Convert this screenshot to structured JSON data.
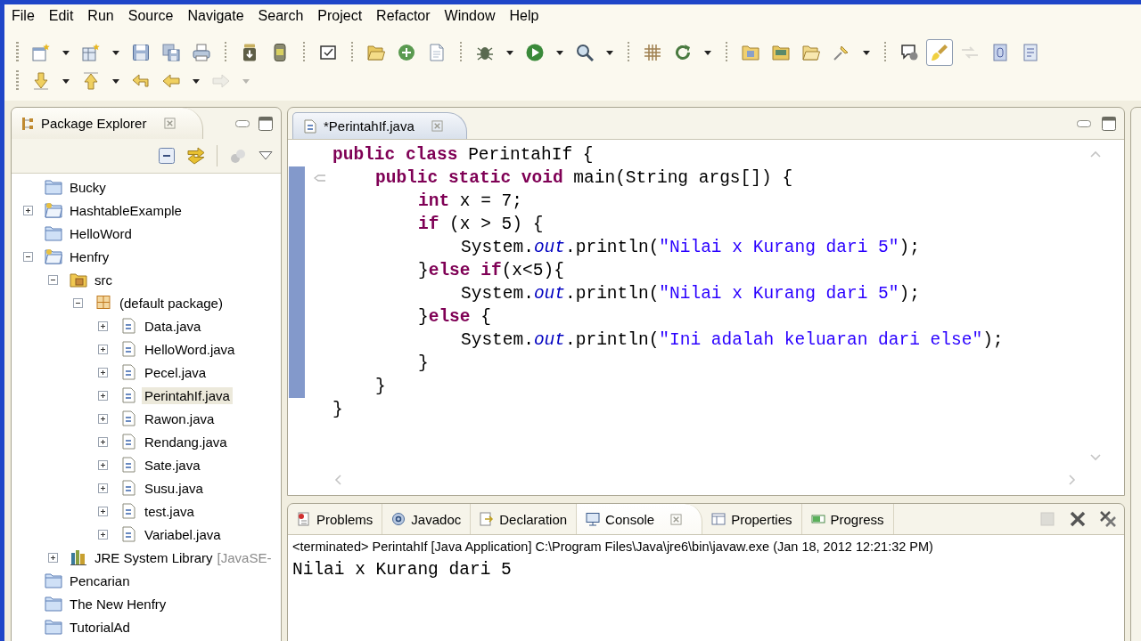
{
  "menu": [
    "File",
    "Edit",
    "Run",
    "Source",
    "Navigate",
    "Search",
    "Project",
    "Refactor",
    "Window",
    "Help"
  ],
  "toolbar": {
    "rows": [
      [
        {
          "pressed": false,
          "disabled": false
        },
        {
          "pressed": false,
          "disabled": false
        },
        {
          "pressed": false,
          "disabled": false
        },
        {
          "pressed": false,
          "disabled": false
        },
        {
          "pressed": false,
          "disabled": false
        },
        {
          "pressed": false,
          "disabled": false
        },
        {
          "pressed": false,
          "disabled": false
        },
        {
          "pressed": false,
          "disabled": false
        },
        {
          "pressed": false,
          "disabled": false
        },
        {
          "pressed": false,
          "disabled": false
        },
        {
          "pressed": false,
          "disabled": false
        },
        {
          "pressed": false,
          "disabled": false
        },
        {
          "pressed": false,
          "disabled": false
        },
        {
          "pressed": false,
          "disabled": false
        },
        {
          "pressed": false,
          "disabled": false
        },
        {
          "pressed": false,
          "disabled": false
        },
        {
          "pressed": false,
          "disabled": false
        },
        {
          "pressed": false,
          "disabled": false
        },
        {
          "pressed": false,
          "disabled": false
        },
        {
          "pressed": false,
          "disabled": false
        },
        {
          "pressed": false,
          "disabled": false
        },
        {
          "pressed": true,
          "disabled": false
        },
        {
          "pressed": false,
          "disabled": true
        },
        {
          "pressed": false,
          "disabled": false
        },
        {
          "pressed": false,
          "disabled": false
        }
      ],
      [
        {
          "pressed": false,
          "disabled": false
        },
        {
          "pressed": false,
          "disabled": false
        },
        {
          "pressed": false,
          "disabled": false
        },
        {
          "pressed": false,
          "disabled": false
        },
        {
          "pressed": false,
          "disabled": true
        }
      ]
    ]
  },
  "package_explorer": {
    "tabs": [
      {
        "label": "Package Explorer",
        "selected": true
      }
    ],
    "tree": [
      {
        "label": "Bucky",
        "kind": "closed-project",
        "selected": false
      },
      {
        "label": "HashtableExample",
        "kind": "project",
        "expanded": false,
        "selected": false
      },
      {
        "label": "HelloWord",
        "kind": "closed-project",
        "selected": false
      },
      {
        "label": "Henfry",
        "kind": "project",
        "expanded": true,
        "selected": false,
        "children": [
          {
            "label": "src",
            "kind": "source-folder",
            "expanded": true,
            "selected": false,
            "children": [
              {
                "label": "(default package)",
                "kind": "package",
                "expanded": true,
                "selected": false,
                "children": [
                  {
                    "label": "Data.java",
                    "kind": "java-file",
                    "expanded": false,
                    "selected": false
                  },
                  {
                    "label": "HelloWord.java",
                    "kind": "java-file",
                    "expanded": false,
                    "selected": false
                  },
                  {
                    "label": "Pecel.java",
                    "kind": "java-file",
                    "expanded": false,
                    "selected": false
                  },
                  {
                    "label": "PerintahIf.java",
                    "kind": "java-file",
                    "expanded": false,
                    "selected": true
                  },
                  {
                    "label": "Rawon.java",
                    "kind": "java-file",
                    "expanded": false,
                    "selected": false
                  },
                  {
                    "label": "Rendang.java",
                    "kind": "java-file",
                    "expanded": false,
                    "selected": false
                  },
                  {
                    "label": "Sate.java",
                    "kind": "java-file",
                    "expanded": false,
                    "selected": false
                  },
                  {
                    "label": "Susu.java",
                    "kind": "java-file",
                    "expanded": false,
                    "selected": false
                  },
                  {
                    "label": "test.java",
                    "kind": "java-file",
                    "expanded": false,
                    "selected": false
                  },
                  {
                    "label": "Variabel.java",
                    "kind": "java-file",
                    "expanded": false,
                    "selected": false
                  }
                ]
              }
            ]
          },
          {
            "label": "JRE System Library",
            "decoration": "[JavaSE-",
            "kind": "library",
            "expanded": false,
            "selected": false
          }
        ]
      },
      {
        "label": "Pencarian",
        "kind": "closed-project",
        "selected": false
      },
      {
        "label": "The New Henfry",
        "kind": "closed-project",
        "selected": false
      },
      {
        "label": "TutorialAd",
        "kind": "closed-project",
        "selected": false
      }
    ]
  },
  "editor": {
    "tabs": [
      {
        "label": "*PerintahIf.java",
        "selected": true
      }
    ],
    "code": [
      {
        "tokens": [
          {
            "kind": "keyword",
            "text": "public class"
          },
          {
            "kind": "plain",
            "text": " PerintahIf {"
          }
        ],
        "selected": false,
        "children": [
          {
            "tokens": [
              {
                "kind": "keyword",
                "text": "public static void"
              },
              {
                "kind": "plain",
                "text": " main(String args[]) {"
              }
            ],
            "selected": true,
            "children": [
              {
                "tokens": [
                  {
                    "kind": "keyword",
                    "text": "int"
                  },
                  {
                    "kind": "plain",
                    "text": " x = 7;"
                  }
                ],
                "selected": false
              },
              {
                "tokens": [
                  {
                    "kind": "keyword",
                    "text": "if"
                  },
                  {
                    "kind": "plain",
                    "text": " (x > 5) {"
                  }
                ],
                "selected": false,
                "children": [
                  {
                    "tokens": [
                      {
                        "kind": "plain",
                        "text": "System."
                      },
                      {
                        "kind": "field",
                        "text": "out"
                      },
                      {
                        "kind": "plain",
                        "text": ".println("
                      },
                      {
                        "kind": "string",
                        "text": "\"Nilai x Kurang dari 5\""
                      },
                      {
                        "kind": "plain",
                        "text": ");"
                      }
                    ],
                    "selected": false
                  }
                ]
              },
              {
                "tokens": [
                  {
                    "kind": "plain",
                    "text": "}"
                  },
                  {
                    "kind": "keyword",
                    "text": "else if"
                  },
                  {
                    "kind": "plain",
                    "text": "(x<5){"
                  }
                ],
                "selected": false,
                "children": [
                  {
                    "tokens": [
                      {
                        "kind": "plain",
                        "text": "System."
                      },
                      {
                        "kind": "field",
                        "text": "out"
                      },
                      {
                        "kind": "plain",
                        "text": ".println("
                      },
                      {
                        "kind": "string",
                        "text": "\"Nilai x Kurang dari 5\""
                      },
                      {
                        "kind": "plain",
                        "text": ");"
                      }
                    ],
                    "selected": false
                  }
                ]
              },
              {
                "tokens": [
                  {
                    "kind": "plain",
                    "text": "}"
                  },
                  {
                    "kind": "keyword",
                    "text": "else"
                  },
                  {
                    "kind": "plain",
                    "text": " {"
                  }
                ],
                "selected": false,
                "children": [
                  {
                    "tokens": [
                      {
                        "kind": "plain",
                        "text": "System."
                      },
                      {
                        "kind": "field",
                        "text": "out"
                      },
                      {
                        "kind": "plain",
                        "text": ".println("
                      },
                      {
                        "kind": "string",
                        "text": "\"Ini adalah keluaran dari else\""
                      },
                      {
                        "kind": "plain",
                        "text": ");"
                      }
                    ],
                    "selected": false
                  }
                ],
                "closing": [
                  {
                    "kind": "plain",
                    "text": "}"
                  }
                ]
              }
            ],
            "closing": [
              {
                "kind": "plain",
                "text": "}"
              }
            ]
          }
        ],
        "closing": [
          {
            "kind": "plain",
            "text": "}"
          }
        ]
      }
    ]
  },
  "console_view": {
    "tabs": [
      {
        "label": "Problems",
        "selected": false
      },
      {
        "label": "Javadoc",
        "selected": false
      },
      {
        "label": "Declaration",
        "selected": false
      },
      {
        "label": "Console",
        "selected": true
      },
      {
        "label": "Properties",
        "selected": false
      },
      {
        "label": "Progress",
        "selected": false
      }
    ],
    "buttons": [
      {
        "disabled": true
      },
      {
        "disabled": false
      },
      {
        "disabled": false
      }
    ],
    "launch_label": "<terminated> PerintahIf [Java Application] C:\\Program Files\\Java\\jre6\\bin\\javaw.exe (Jan 18, 2012 12:21:32 PM)",
    "output": [
      "Nilai x Kurang dari 5"
    ]
  }
}
